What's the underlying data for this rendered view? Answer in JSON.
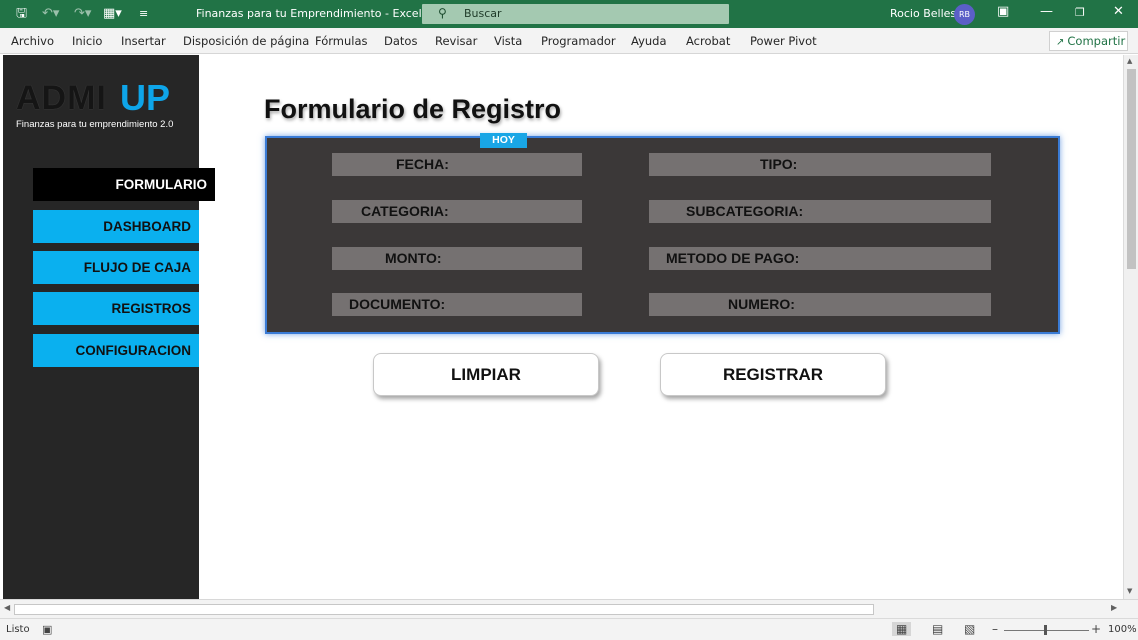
{
  "app": {
    "doc_title": "Finanzas para tu Emprendimiento  -  Excel",
    "search_placeholder": "Buscar",
    "user_name": "Rocio Bellesi",
    "user_initials": "RB"
  },
  "ribbon": {
    "tabs": [
      "Archivo",
      "Inicio",
      "Insertar",
      "Disposición de página",
      "Fórmulas",
      "Datos",
      "Revisar",
      "Vista",
      "Programador",
      "Ayuda",
      "Acrobat",
      "Power Pivot"
    ],
    "share_label": "Compartir"
  },
  "logo": {
    "main": "ADMI",
    "accent": "UP",
    "subtitle": "Finanzas para tu emprendimiento 2.0"
  },
  "nav": {
    "items": [
      "FORMULARIO",
      "DASHBOARD",
      "FLUJO DE CAJA",
      "REGISTROS",
      "CONFIGURACION"
    ],
    "active": "FORMULARIO"
  },
  "form": {
    "title": "Formulario de Registro",
    "badge": "HOY",
    "fields": {
      "fecha": "FECHA:",
      "tipo": "TIPO:",
      "categoria": "CATEGORIA:",
      "subcategoria": "SUBCATEGORIA:",
      "monto": "MONTO:",
      "metodo_pago": "METODO DE PAGO:",
      "documento": "DOCUMENTO:",
      "numero": "NUMERO:"
    },
    "buttons": {
      "limpiar": "LIMPIAR",
      "registrar": "REGISTRAR"
    }
  },
  "status": {
    "ready": "Listo",
    "zoom": "100%"
  },
  "colors": {
    "excel_green": "#217346",
    "nav_blue": "#0ab0ef",
    "panel_dark": "#3b3838",
    "field_gray": "#757171",
    "logo_accent": "#0ea5e9"
  }
}
